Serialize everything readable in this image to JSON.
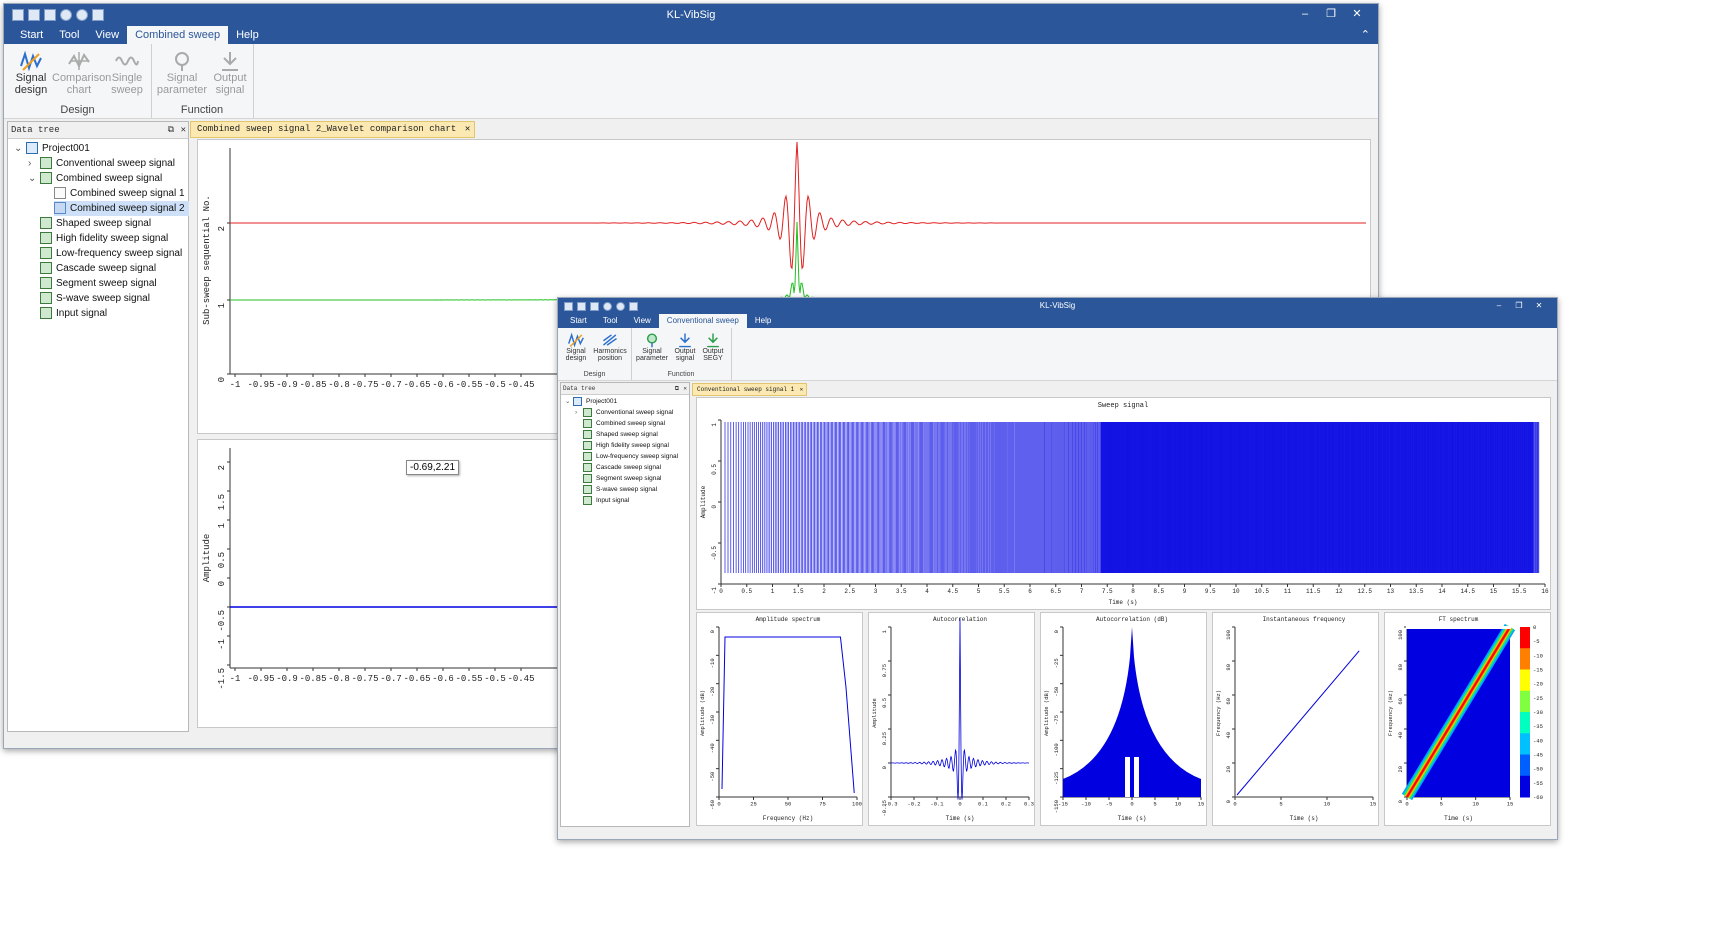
{
  "back": {
    "title": "KL-VibSig",
    "tabs": [
      "Start",
      "Tool",
      "View",
      "Combined sweep",
      "Help"
    ],
    "active_tab": "Combined sweep",
    "groups": [
      {
        "name": "Design",
        "buttons": [
          {
            "label1": "Signal",
            "label2": "design"
          },
          {
            "label1": "Comparison",
            "label2": "chart"
          },
          {
            "label1": "Single",
            "label2": "sweep"
          }
        ]
      },
      {
        "name": "Function",
        "buttons": [
          {
            "label1": "Signal",
            "label2": "parameter"
          },
          {
            "label1": "Output",
            "label2": "signal"
          }
        ]
      }
    ],
    "tree_header": "Data tree",
    "tree": [
      "Project001",
      "Conventional sweep signal",
      "Combined sweep signal",
      "Combined sweep signal 1",
      "Combined sweep signal 2",
      "Shaped sweep signal",
      "High fidelity sweep signal",
      "Low-frequency sweep signal",
      "Cascade sweep signal",
      "Segment sweep signal",
      "S-wave sweep signal",
      "Input signal"
    ],
    "doc_tab": "Combined sweep signal 2_Wavelet comparison chart",
    "top_chart": {
      "ylabel": "Sub-sweep sequential No.",
      "yticks": [
        "0",
        "1",
        "2"
      ],
      "xticks": [
        "-1",
        "-0.95",
        "-0.9",
        "-0.85",
        "-0.8",
        "-0.75",
        "-0.7",
        "-0.65",
        "-0.6",
        "-0.55",
        "-0.5",
        "-0.45"
      ]
    },
    "bottom_chart": {
      "ylabel": "Amplitude",
      "yticks": [
        "2",
        "1.5",
        "1",
        "0.5",
        "0",
        "-0.5",
        "-1",
        "-1.5"
      ],
      "xticks": [
        "-1",
        "-0.95",
        "-0.9",
        "-0.85",
        "-0.8",
        "-0.75",
        "-0.7",
        "-0.65",
        "-0.6",
        "-0.55",
        "-0.5",
        "-0.45"
      ],
      "tooltip": "-0.69,2.21"
    },
    "colors": {
      "red": "#e02020",
      "green": "#20c020",
      "blue": "#0000e0"
    }
  },
  "front": {
    "title": "KL-VibSig",
    "tabs": [
      "Start",
      "Tool",
      "View",
      "Conventional sweep",
      "Help"
    ],
    "active_tab": "Conventional sweep",
    "groups": [
      {
        "name": "Design",
        "buttons": [
          {
            "label1": "Signal",
            "label2": "design"
          },
          {
            "label1": "Harmonics",
            "label2": "position"
          }
        ]
      },
      {
        "name": "Function",
        "buttons": [
          {
            "label1": "Signal",
            "label2": "parameter"
          },
          {
            "label1": "Output",
            "label2": "signal"
          },
          {
            "label1": "Output",
            "label2": "SEGY"
          }
        ]
      }
    ],
    "tree_header": "Data tree",
    "tree": [
      "Project001",
      "Conventional sweep signal",
      "Combined sweep signal",
      "Shaped sweep signal",
      "High fidelity sweep signal",
      "Low-frequency sweep signal",
      "Cascade sweep signal",
      "Segment sweep signal",
      "S-wave sweep signal",
      "Input signal"
    ],
    "doc_tab": "Conventional sweep signal 1",
    "sweep": {
      "title": "Sweep signal",
      "xlabel": "Time (s)",
      "ylabel": "Amplitude",
      "yticks": [
        "1",
        "0.5",
        "0",
        "-0.5",
        "-1"
      ],
      "xticks": [
        "0",
        "0.5",
        "1",
        "1.5",
        "2",
        "2.5",
        "3",
        "3.5",
        "4",
        "4.5",
        "5",
        "5.5",
        "6",
        "6.5",
        "7",
        "7.5",
        "8",
        "8.5",
        "9",
        "9.5",
        "10",
        "10.5",
        "11",
        "11.5",
        "12",
        "12.5",
        "13",
        "13.5",
        "14",
        "14.5",
        "15",
        "15.5",
        "16"
      ]
    },
    "small": [
      {
        "title": "Amplitude spectrum",
        "xlabel": "Frequency (Hz)",
        "ylabel": "Amplitude (dB)",
        "yticks": [
          "0",
          "-10",
          "-20",
          "-30",
          "-40",
          "-50",
          "-60"
        ],
        "xticks": [
          "0",
          "25",
          "50",
          "75",
          "100"
        ]
      },
      {
        "title": "Autocorrelation",
        "xlabel": "Time (s)",
        "ylabel": "Amplitude",
        "yticks": [
          "1",
          "0.75",
          "0.5",
          "0.25",
          "0",
          "-0.25"
        ],
        "xticks": [
          "-0.3",
          "-0.2",
          "-0.1",
          "0",
          "0.1",
          "0.2",
          "0.3"
        ]
      },
      {
        "title": "Autocorrelation (dB)",
        "xlabel": "Time (s)",
        "ylabel": "Amplitude (dB)",
        "yticks": [
          "0",
          "-25",
          "-50",
          "-75",
          "-100",
          "-125",
          "-150"
        ],
        "xticks": [
          "-15",
          "-10",
          "-5",
          "0",
          "5",
          "10",
          "15"
        ]
      },
      {
        "title": "Instantaneous frequency",
        "xlabel": "Time (s)",
        "ylabel": "Frequency (Hz)",
        "yticks": [
          "100",
          "80",
          "60",
          "40",
          "20",
          "0"
        ],
        "xticks": [
          "0",
          "5",
          "10",
          "15"
        ]
      },
      {
        "title": "FT spectrum",
        "xlabel": "Time (s)",
        "ylabel": "Frequency (Hz)",
        "yticks": [
          "100",
          "80",
          "60",
          "40",
          "20",
          "0"
        ],
        "xticks": [
          "0",
          "5",
          "10",
          "15"
        ],
        "colorbar": [
          "0",
          "-5",
          "-10",
          "-15",
          "-20",
          "-25",
          "-30",
          "-35",
          "-40",
          "-45",
          "-50",
          "-55",
          "-60"
        ]
      }
    ]
  }
}
